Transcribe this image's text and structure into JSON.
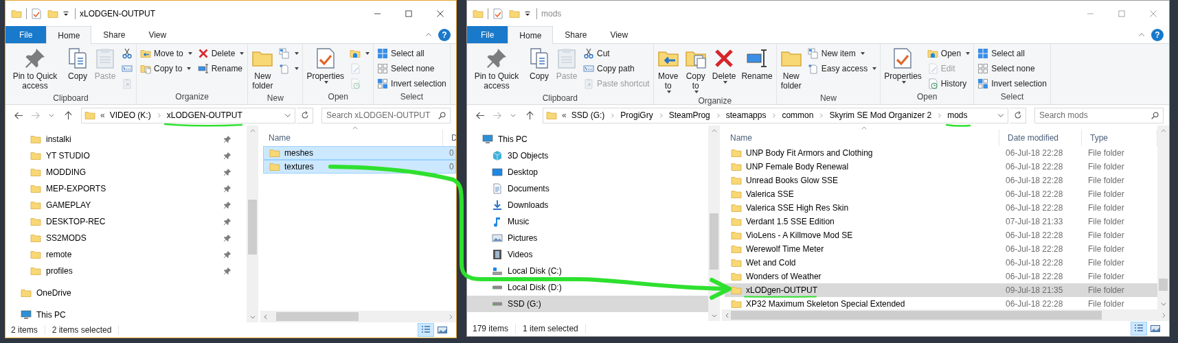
{
  "windows": [
    {
      "active": true,
      "title": "xLODGEN-OUTPUT",
      "help": "?",
      "tabs": [
        {
          "label": "File",
          "kind": "menu",
          "selected": false
        },
        {
          "label": "Home",
          "kind": "tab",
          "selected": true
        },
        {
          "label": "Share",
          "kind": "tab",
          "selected": false
        },
        {
          "label": "View",
          "kind": "tab",
          "selected": false
        }
      ],
      "ribbon": [
        {
          "label": "Clipboard",
          "stacks": [
            [
              {
                "kind": "large",
                "label": "Pin to Quick access",
                "dropdown": false,
                "disabled": false
              }
            ],
            [
              {
                "kind": "large",
                "label": "Copy",
                "dropdown": false,
                "disabled": false
              }
            ],
            [
              {
                "kind": "large",
                "label": "Paste",
                "dropdown": false,
                "disabled": true
              }
            ],
            [
              {
                "kind": "icon",
                "dropdown": false,
                "disabled": false
              },
              {
                "kind": "icon",
                "dropdown": false,
                "disabled": false
              },
              {
                "kind": "icon",
                "dropdown": false,
                "disabled": true
              }
            ]
          ]
        },
        {
          "label": "Organize",
          "stacks": [
            [
              {
                "kind": "small",
                "label": "Move to",
                "dropdown": true,
                "disabled": false
              },
              {
                "kind": "small",
                "label": "Copy to",
                "dropdown": true,
                "disabled": false
              }
            ],
            [
              {
                "kind": "small",
                "label": "Delete",
                "dropdown": true,
                "disabled": false
              },
              {
                "kind": "small",
                "label": "Rename",
                "dropdown": false,
                "disabled": false
              }
            ]
          ]
        },
        {
          "label": "New",
          "stacks": [
            [
              {
                "kind": "large",
                "label": "New folder",
                "dropdown": false,
                "disabled": false
              }
            ],
            [
              {
                "kind": "icon",
                "dropdown": true,
                "disabled": false
              },
              {
                "kind": "icon",
                "dropdown": true,
                "disabled": false
              }
            ]
          ]
        },
        {
          "label": "Open",
          "stacks": [
            [
              {
                "kind": "large",
                "label": "Properties",
                "dropdown": true,
                "disabled": false
              }
            ],
            [
              {
                "kind": "icon",
                "dropdown": true,
                "disabled": false
              },
              {
                "kind": "icon",
                "dropdown": false,
                "disabled": true
              },
              {
                "kind": "icon",
                "dropdown": false,
                "disabled": true
              }
            ]
          ]
        },
        {
          "label": "Select",
          "stacks": [
            [
              {
                "kind": "small",
                "label": "Select all",
                "dropdown": false,
                "disabled": false
              },
              {
                "kind": "small",
                "label": "Select none",
                "dropdown": false,
                "disabled": false
              },
              {
                "kind": "small",
                "label": "Invert selection",
                "dropdown": false,
                "disabled": false
              }
            ]
          ]
        }
      ],
      "address": {
        "overflow": "«",
        "crumbs": [
          "VIDEO (K:)",
          "xLODGEN-OUTPUT"
        ]
      },
      "search": {
        "placeholder": "Search xLODGEN-OUTPUT"
      },
      "nav": [
        {
          "children": [
            {
              "label": "instalki",
              "pinned": true,
              "selected": false
            },
            {
              "label": "YT STUDIO",
              "pinned": true,
              "selected": false
            },
            {
              "label": "MODDING",
              "pinned": true,
              "selected": false
            },
            {
              "label": "MEP-EXPORTS",
              "pinned": true,
              "selected": false
            },
            {
              "label": "GAMEPLAY",
              "pinned": true,
              "selected": false
            },
            {
              "label": "DESKTOP-REC",
              "pinned": true,
              "selected": false
            },
            {
              "label": "SS2MODS",
              "pinned": true,
              "selected": false
            },
            {
              "label": "remote",
              "pinned": true,
              "selected": false
            },
            {
              "label": "profiles",
              "pinned": true,
              "selected": false
            }
          ]
        },
        {
          "label": "OneDrive",
          "pinned": false,
          "selected": false
        },
        {
          "label": "This PC",
          "pinned": false,
          "selected": false
        }
      ],
      "columns": [
        "Name",
        "D"
      ],
      "rows": [
        {
          "cells": [
            "meshes",
            "0"
          ],
          "selected": true
        },
        {
          "cells": [
            "textures",
            "0"
          ],
          "selected": true
        }
      ],
      "status": [
        "2 items",
        "2 items selected"
      ],
      "views": [
        {
          "selected": true
        },
        {
          "selected": false
        }
      ]
    },
    {
      "active": false,
      "title": "mods",
      "help": "?",
      "tabs": [
        {
          "label": "File",
          "kind": "menu",
          "selected": false
        },
        {
          "label": "Home",
          "kind": "tab",
          "selected": true
        },
        {
          "label": "Share",
          "kind": "tab",
          "selected": false
        },
        {
          "label": "View",
          "kind": "tab",
          "selected": false
        }
      ],
      "ribbon": [
        {
          "label": "Clipboard",
          "stacks": [
            [
              {
                "kind": "large",
                "label": "Pin to Quick access",
                "dropdown": false,
                "disabled": false
              }
            ],
            [
              {
                "kind": "large",
                "label": "Copy",
                "dropdown": false,
                "disabled": false
              }
            ],
            [
              {
                "kind": "large",
                "label": "Paste",
                "dropdown": false,
                "disabled": true
              }
            ],
            [
              {
                "kind": "small",
                "label": "Cut",
                "dropdown": false,
                "disabled": false
              },
              {
                "kind": "small",
                "label": "Copy path",
                "dropdown": false,
                "disabled": false
              },
              {
                "kind": "small",
                "label": "Paste shortcut",
                "dropdown": false,
                "disabled": true
              }
            ]
          ]
        },
        {
          "label": "Organize",
          "stacks": [
            [
              {
                "kind": "large",
                "label": "Move to",
                "dropdown": true,
                "disabled": false
              }
            ],
            [
              {
                "kind": "large",
                "label": "Copy to",
                "dropdown": true,
                "disabled": false
              }
            ],
            [
              {
                "kind": "large",
                "label": "Delete",
                "dropdown": true,
                "disabled": false
              }
            ],
            [
              {
                "kind": "large",
                "label": "Rename",
                "dropdown": false,
                "disabled": false
              }
            ]
          ]
        },
        {
          "label": "New",
          "stacks": [
            [
              {
                "kind": "large",
                "label": "New folder",
                "dropdown": false,
                "disabled": false
              }
            ],
            [
              {
                "kind": "small",
                "label": "New item",
                "dropdown": true,
                "disabled": false
              },
              {
                "kind": "small",
                "label": "Easy access",
                "dropdown": true,
                "disabled": false
              }
            ]
          ]
        },
        {
          "label": "Open",
          "stacks": [
            [
              {
                "kind": "large",
                "label": "Properties",
                "dropdown": true,
                "disabled": false
              }
            ],
            [
              {
                "kind": "small",
                "label": "Open",
                "dropdown": true,
                "disabled": false
              },
              {
                "kind": "small",
                "label": "Edit",
                "dropdown": false,
                "disabled": true
              },
              {
                "kind": "small",
                "label": "History",
                "dropdown": false,
                "disabled": false
              }
            ]
          ]
        },
        {
          "label": "Select",
          "stacks": [
            [
              {
                "kind": "small",
                "label": "Select all",
                "dropdown": false,
                "disabled": false
              },
              {
                "kind": "small",
                "label": "Select none",
                "dropdown": false,
                "disabled": false
              },
              {
                "kind": "small",
                "label": "Invert selection",
                "dropdown": false,
                "disabled": false
              }
            ]
          ]
        }
      ],
      "address": {
        "overflow": "«",
        "crumbs": [
          "SSD (G:)",
          "ProgiGry",
          "SteamProg",
          "steamapps",
          "common",
          "Skyrim SE Mod Organizer 2",
          "mods"
        ]
      },
      "search": {
        "placeholder": "Search mods"
      },
      "nav": [
        {
          "label": "This PC",
          "pinned": false,
          "selected": false,
          "children": [
            {
              "label": "3D Objects",
              "pinned": false,
              "selected": false
            },
            {
              "label": "Desktop",
              "pinned": false,
              "selected": false
            },
            {
              "label": "Documents",
              "pinned": false,
              "selected": false
            },
            {
              "label": "Downloads",
              "pinned": false,
              "selected": false
            },
            {
              "label": "Music",
              "pinned": false,
              "selected": false
            },
            {
              "label": "Pictures",
              "pinned": false,
              "selected": false
            },
            {
              "label": "Videos",
              "pinned": false,
              "selected": false
            },
            {
              "label": "Local Disk (C:)",
              "pinned": false,
              "selected": false
            },
            {
              "label": "Local Disk (D:)",
              "pinned": false,
              "selected": false
            },
            {
              "label": "SSD (G:)",
              "pinned": false,
              "selected": true
            }
          ]
        }
      ],
      "columns": [
        "Name",
        "Date modified",
        "Type"
      ],
      "rows": [
        {
          "cells": [
            "UNP Body Fit Armors and Clothing",
            "06-Jul-18 22:28",
            "File folder"
          ],
          "selected": false
        },
        {
          "cells": [
            "UNP Female Body Renewal",
            "06-Jul-18 22:28",
            "File folder"
          ],
          "selected": false
        },
        {
          "cells": [
            "Unread Books Glow SSE",
            "06-Jul-18 22:28",
            "File folder"
          ],
          "selected": false
        },
        {
          "cells": [
            "Valerica SSE",
            "06-Jul-18 22:28",
            "File folder"
          ],
          "selected": false
        },
        {
          "cells": [
            "Valerica SSE High Res Skin",
            "06-Jul-18 22:28",
            "File folder"
          ],
          "selected": false
        },
        {
          "cells": [
            "Verdant 1.5 SSE Edition",
            "07-Jul-18 21:33",
            "File folder"
          ],
          "selected": false
        },
        {
          "cells": [
            "VioLens - A Killmove Mod SE",
            "06-Jul-18 22:28",
            "File folder"
          ],
          "selected": false
        },
        {
          "cells": [
            "Werewolf Time Meter",
            "06-Jul-18 22:28",
            "File folder"
          ],
          "selected": false
        },
        {
          "cells": [
            "Wet and Cold",
            "06-Jul-18 22:28",
            "File folder"
          ],
          "selected": false
        },
        {
          "cells": [
            "Wonders of Weather",
            "06-Jul-18 22:28",
            "File folder"
          ],
          "selected": false
        },
        {
          "cells": [
            "xLODgen-OUTPUT",
            "09-Jul-18 21:35",
            "File folder"
          ],
          "selected": true
        },
        {
          "cells": [
            "XP32 Maximum Skeleton Special Extended",
            "06-Jul-18 22:28",
            "File folder"
          ],
          "selected": false
        }
      ],
      "status": [
        "179 items",
        "1 item selected"
      ],
      "views": [
        {
          "selected": true
        },
        {
          "selected": false
        }
      ]
    }
  ]
}
